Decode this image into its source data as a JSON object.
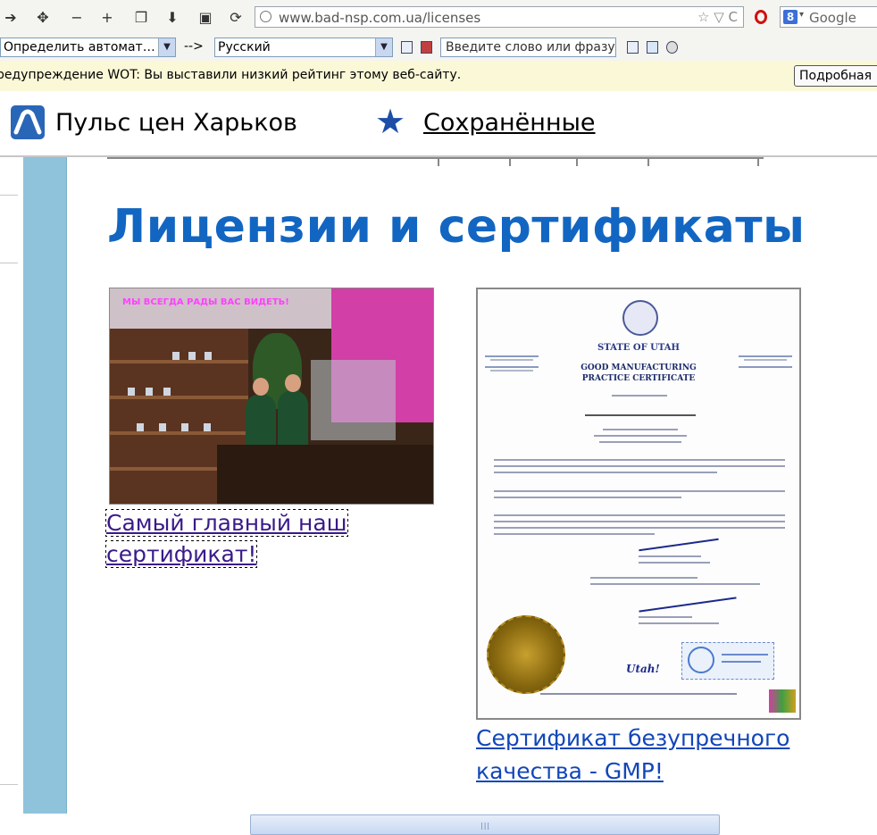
{
  "browser": {
    "nav_icons": [
      "arrow-right-icon",
      "move-icon",
      "zoom-out-icon",
      "zoom-in-icon",
      "copy-icon",
      "download-icon",
      "window-icon",
      "reload-icon"
    ],
    "url": "www.bad-nsp.com.ua/licenses",
    "url_controls": "☆ ▽ C",
    "search_engine": "Google",
    "search_badge": "8"
  },
  "translator": {
    "source_language": "Определить автомат…",
    "arrow": "-->",
    "target_language": "Русский",
    "phrase_placeholder": "Введите слово или фразу"
  },
  "wot": {
    "warning": "редупреждение WOT: Вы выставили низкий рейтинг этому веб-сайту.",
    "details_button": "Подробная"
  },
  "site_header": {
    "title": "Пульс цен Харьков",
    "saved_link": "Сохранённые"
  },
  "page": {
    "title": "Лицензии и сертификаты",
    "photo": {
      "banner_text": "МЫ ВСЕГДА РАДЫ ВАС ВИДЕТЬ!",
      "link_text": "Самый главный наш сертификат!"
    },
    "certificate": {
      "state": "STATE OF UTAH",
      "heading_line1": "GOOD MANUFACTURING",
      "heading_line2": "PRACTICE CERTIFICATE",
      "stamp_text": "Utah!",
      "link_text": "Сертификат безупречного качества - GMP!"
    }
  },
  "colors": {
    "title_blue": "#1266c2",
    "side_column": "#8fc3dc",
    "link_visited": "#3a1a8a",
    "link": "#1246b8"
  }
}
